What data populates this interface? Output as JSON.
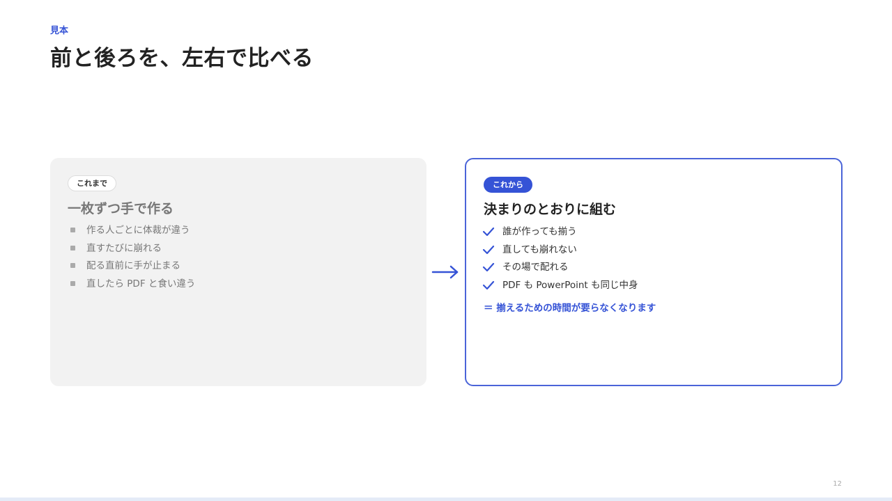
{
  "slide": {
    "eyebrow": "見本",
    "title": "前と後ろを、左右で比べる",
    "page_number": "12"
  },
  "before": {
    "badge": "これまで",
    "heading": "一枚ずつ手で作る",
    "items": [
      "作る人ごとに体裁が違う",
      "直すたびに崩れる",
      "配る直前に手が止まる",
      "直したら PDF と食い違う"
    ]
  },
  "after": {
    "badge": "これから",
    "heading": "決まりのとおりに組む",
    "items": [
      "誰が作っても揃う",
      "直しても崩れない",
      "その場で配れる",
      "PDF も PowerPoint も同じ中身"
    ],
    "emphasis": "＝ 揃えるための時間が要らなくなります"
  },
  "icons": {
    "transition": "right-arrow-icon",
    "after_bullet": "check-icon",
    "before_bullet": "square-bullet-icon"
  },
  "colors": {
    "accent": "#3553d6",
    "before_card_bg": "#f2f2f2",
    "after_card_border": "#4a64d8"
  }
}
